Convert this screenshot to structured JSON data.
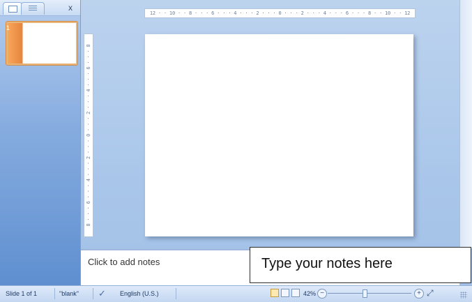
{
  "slides_pane": {
    "close_label": "x",
    "thumbnails": [
      {
        "number": "1"
      }
    ]
  },
  "rulers": {
    "horizontal_text": "12 · · 10 · · 8 · · · 6 · · · 4 · · · 2 · · · 0 · · · 2 · · · 4 · · · 6 · · · 8 · · 10 · · 12",
    "vertical_text": "8 · · · 6 · · · 4 · · · 2 · · · 0 · · · 2 · · · 4 · · · 6 · · · 8"
  },
  "notes": {
    "placeholder": "Click to add notes"
  },
  "callout": {
    "text": "Type your notes here"
  },
  "status_bar": {
    "slide_indicator": "Slide 1 of 1",
    "theme": "\"blank\"",
    "spell_icon": "spell-check-icon",
    "language": "English (U.S.)",
    "zoom": "42%",
    "zoom_level_percent": 42,
    "zoom_out_label": "−",
    "zoom_in_label": "+",
    "fit_label": "⤢"
  },
  "colors": {
    "thumbnail_accent": "#e6843d",
    "pane_blue": "#5f8fd0",
    "workspace_blue": "#a9c6ea"
  }
}
